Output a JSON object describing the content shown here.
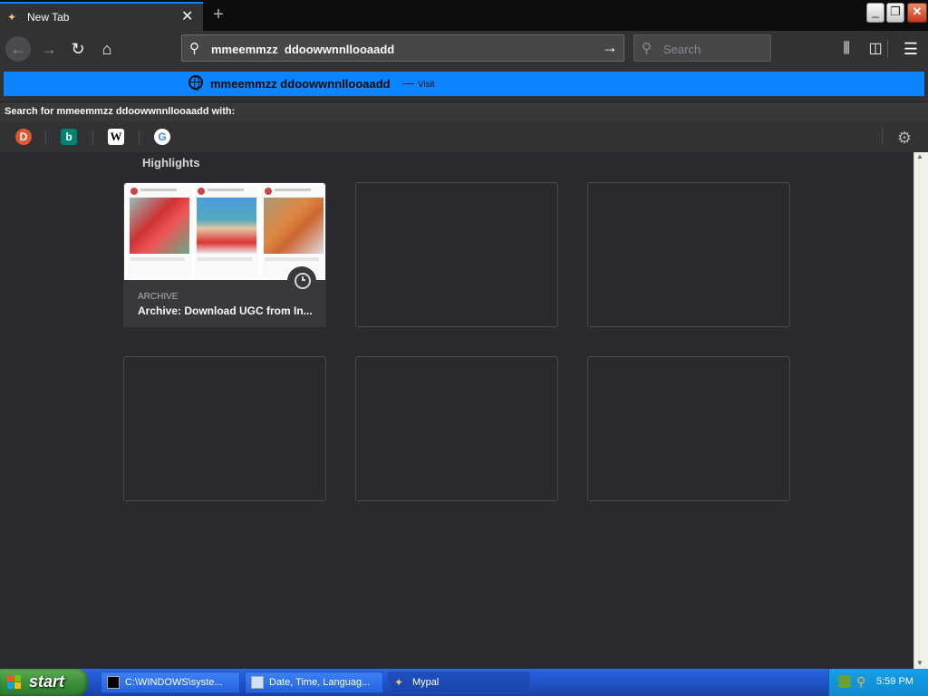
{
  "tab": {
    "title": "New Tab",
    "close": "✕",
    "new_tab": "+"
  },
  "window": {
    "minimize": "_",
    "maximize": "❐",
    "close": "✕"
  },
  "nav": {
    "back": "←",
    "forward": "→",
    "reload": "↻",
    "home": "⌂"
  },
  "urlbar": {
    "value": "mmeemmzz  ddoowwnnllooaadd",
    "go": "→"
  },
  "searchbar": {
    "placeholder": "Search"
  },
  "toolbar": {
    "library": "⫼",
    "sidebar": "◫",
    "menu": "☰"
  },
  "suggestion": {
    "text": "mmeemmzz  ddoowwnnllooaadd",
    "dash": "—",
    "action": "Visit"
  },
  "search_with": "Search for mmeemmzz  ddoowwnnllooaadd with:",
  "engines": [
    {
      "name": "duckduckgo",
      "glyph": "D"
    },
    {
      "name": "bing",
      "glyph": "b"
    },
    {
      "name": "wikipedia",
      "glyph": "W"
    },
    {
      "name": "google",
      "glyph": "G"
    }
  ],
  "settings_glyph": "⚙",
  "highlights": {
    "title": "Highlights",
    "cards": [
      {
        "label": "ARCHIVE",
        "title": "Archive: Download UGC from In..."
      }
    ]
  },
  "taskbar": {
    "start": "start",
    "tasks": [
      {
        "label": "C:\\WINDOWS\\syste..."
      },
      {
        "label": "Date, Time, Languag..."
      },
      {
        "label": "Mypal"
      }
    ],
    "clock": "5:59 PM"
  }
}
